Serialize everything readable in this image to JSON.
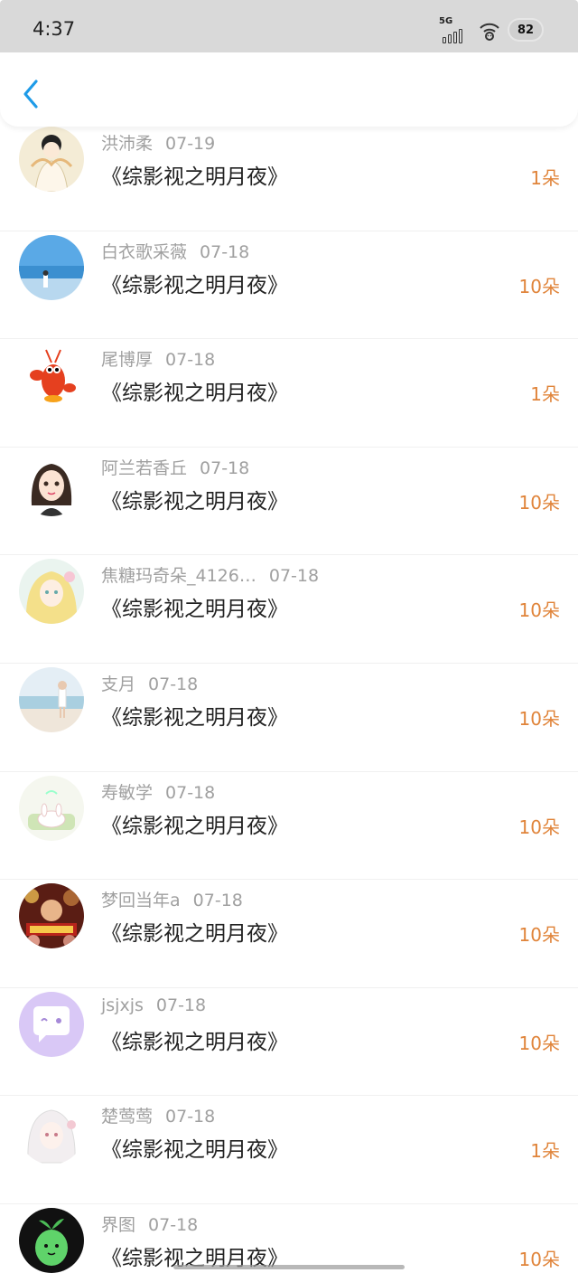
{
  "status_bar": {
    "time": "4:37",
    "network": "5G",
    "battery": "82"
  },
  "header": {
    "back_icon": "chevron-left-icon"
  },
  "accent_color": "#e0843a",
  "back_color": "#1e9be8",
  "rows": [
    {
      "name": "洪沛柔",
      "date": "07-19",
      "title": "《综影视之明月夜》",
      "gift": "1朵",
      "avatar": "hug-cartoon"
    },
    {
      "name": "白衣歌采薇",
      "date": "07-18",
      "title": "《综影视之明月夜》",
      "gift": "10朵",
      "avatar": "seaside-photo"
    },
    {
      "name": "尾博厚",
      "date": "07-18",
      "title": "《综影视之明月夜》",
      "gift": "1朵",
      "avatar": "lobster-cartoon"
    },
    {
      "name": "阿兰若香丘",
      "date": "07-18",
      "title": "《综影视之明月夜》",
      "gift": "10朵",
      "avatar": "girl-cartoon"
    },
    {
      "name": "焦糖玛奇朵_4126…",
      "date": "07-18",
      "title": "《综影视之明月夜》",
      "gift": "10朵",
      "avatar": "anime-girl"
    },
    {
      "name": "支月",
      "date": "07-18",
      "title": "《综影视之明月夜》",
      "gift": "10朵",
      "avatar": "beach-girl"
    },
    {
      "name": "寿敏学",
      "date": "07-18",
      "title": "《综影视之明月夜》",
      "gift": "10朵",
      "avatar": "bunny-cartoon"
    },
    {
      "name": "梦回当年a",
      "date": "07-18",
      "title": "《综影视之明月夜》",
      "gift": "10朵",
      "avatar": "movie-poster"
    },
    {
      "name": "jsjxjs",
      "date": "07-18",
      "title": "《综影视之明月夜》",
      "gift": "10朵",
      "avatar": "chat-bubble"
    },
    {
      "name": "楚莺莺",
      "date": "07-18",
      "title": "《综影视之明月夜》",
      "gift": "1朵",
      "avatar": "white-hair-girl"
    },
    {
      "name": "界图",
      "date": "07-18",
      "title": "《综影视之明月夜》",
      "gift": "10朵",
      "avatar": "green-bean"
    }
  ]
}
